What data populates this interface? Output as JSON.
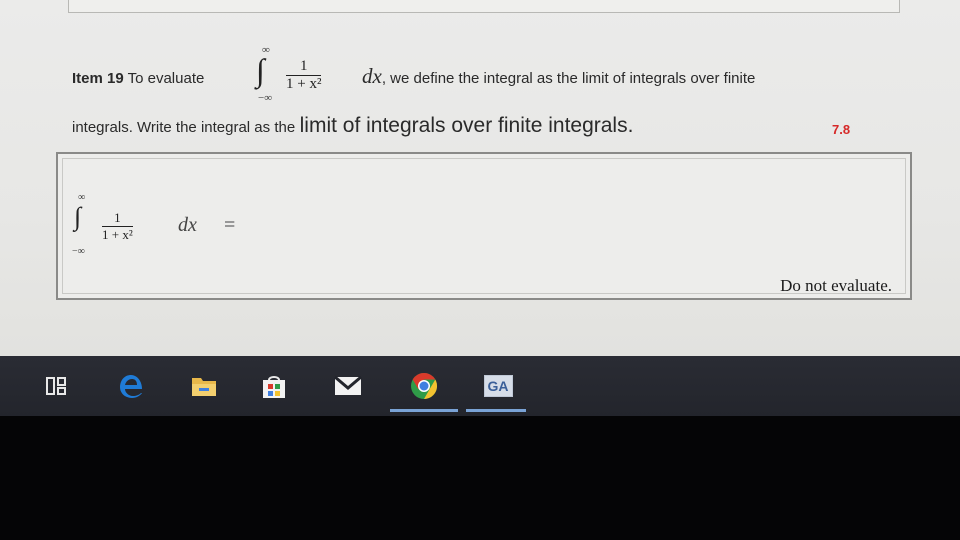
{
  "question": {
    "item_label": "Item 19",
    "intro": "To evaluate",
    "integral": {
      "upper": "∞",
      "lower": "−∞",
      "numerator": "1",
      "denominator": "1 + x²",
      "differential": "dx"
    },
    "line1_rest": ", we define the integral as the limit of integrals over finite",
    "line2_small": "integrals. Write the integral as the",
    "line2_big": "limit of integrals over finite integrals.",
    "score": "7.8"
  },
  "answer": {
    "integral": {
      "upper": "∞",
      "lower": "−∞",
      "numerator": "1",
      "denominator": "1 + x²",
      "differential": "dx"
    },
    "equals": "=",
    "note": "Do not evaluate."
  },
  "taskbar": {
    "items": [
      {
        "name": "task-view-icon"
      },
      {
        "name": "edge-icon"
      },
      {
        "name": "file-explorer-icon"
      },
      {
        "name": "store-icon"
      },
      {
        "name": "mail-icon"
      },
      {
        "name": "chrome-icon"
      },
      {
        "name": "ga-app-icon",
        "label": "GA"
      }
    ],
    "colors": {
      "edge": "#1f7bd6",
      "folder": "#e8b84a",
      "chrome_red": "#d93a2b",
      "chrome_yellow": "#f2c230",
      "chrome_green": "#2f9b48",
      "chrome_blue": "#3f7fe0"
    }
  }
}
